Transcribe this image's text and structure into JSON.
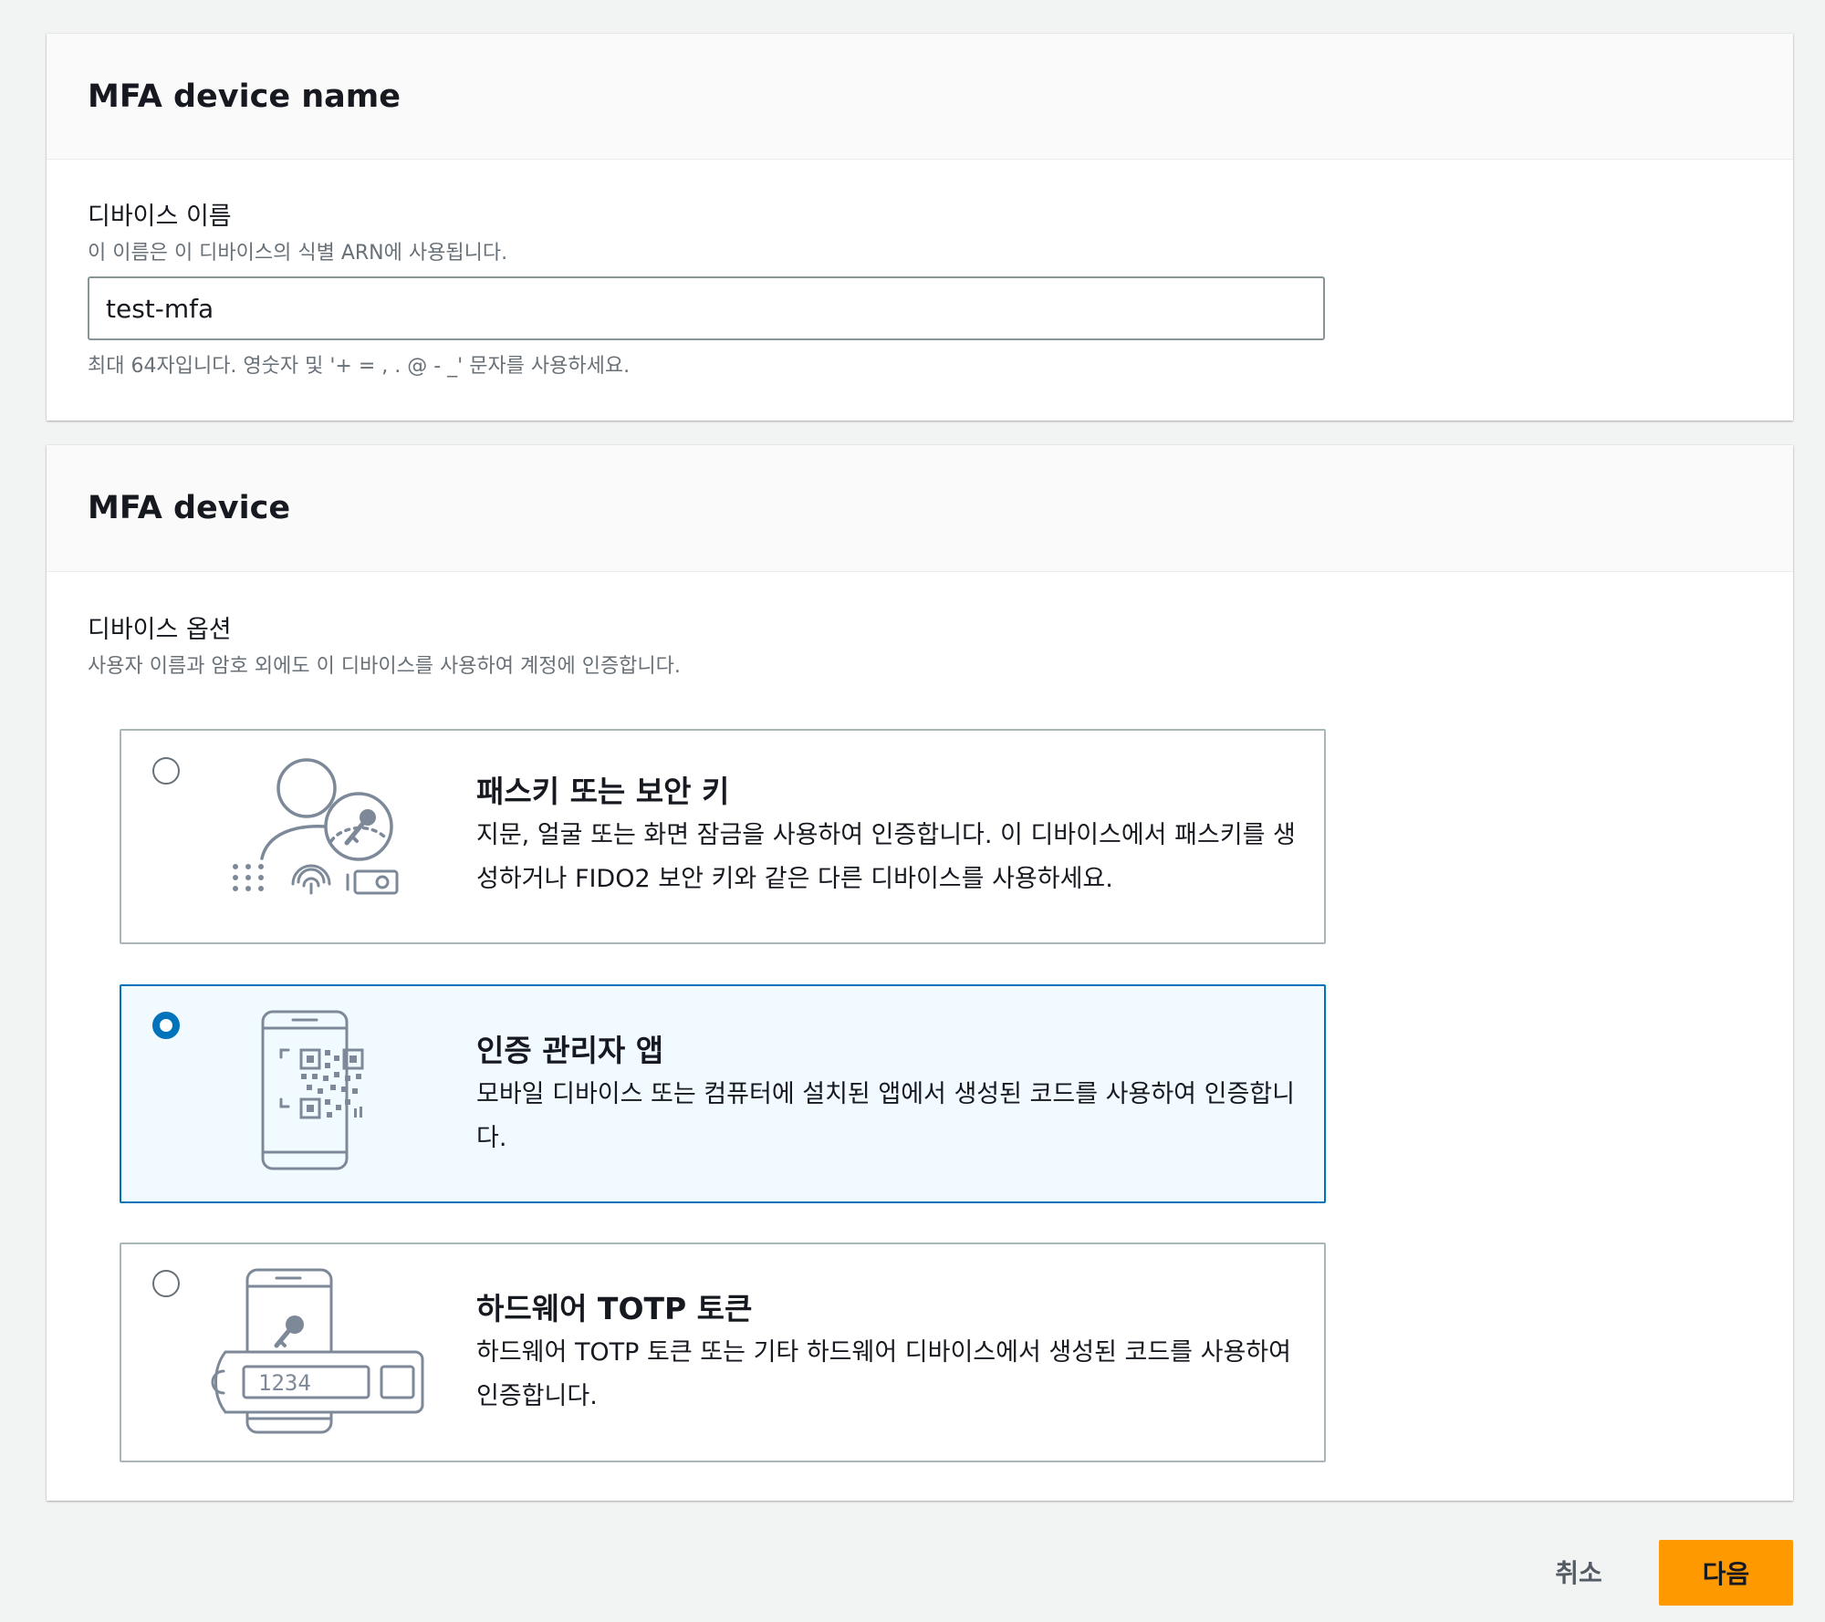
{
  "name_section": {
    "title": "MFA device name",
    "label": "디바이스 이름",
    "description": "이 이름은 이 디바이스의 식별 ARN에 사용됩니다.",
    "value": "test-mfa",
    "constraint": "최대 64자입니다. 영숫자 및 '+ = , . @ - _' 문자를 사용하세요."
  },
  "device_section": {
    "title": "MFA device",
    "label": "디바이스 옵션",
    "description": "사용자 이름과 암호 외에도 이 디바이스를 사용하여 계정에 인증합니다.",
    "selected_option": "authenticator_app",
    "options": [
      {
        "id": "passkey",
        "title": "패스키 또는 보안 키",
        "description": "지문, 얼굴 또는 화면 잠금을 사용하여 인증합니다. 이 디바이스에서 패스키를 생성하거나 FIDO2 보안 키와 같은 다른 디바이스를 사용하세요.",
        "icon": "passkey-user-key-icon",
        "selected": false
      },
      {
        "id": "authenticator_app",
        "title": "인증 관리자 앱",
        "description": "모바일 디바이스 또는 컴퓨터에 설치된 앱에서 생성된 코드를 사용하여 인증합니다.",
        "icon": "phone-qr-code-icon",
        "selected": true
      },
      {
        "id": "hardware_totp",
        "title": "하드웨어 TOTP 토큰",
        "description": "하드웨어 TOTP 토큰 또는 기타 하드웨어 디바이스에서 생성된 코드를 사용하여 인증합니다.",
        "icon": "hardware-token-icon",
        "token_display": "1234",
        "selected": false
      }
    ]
  },
  "footer": {
    "cancel_label": "취소",
    "next_label": "다음"
  },
  "colors": {
    "primary_button": "#ff9900",
    "selected_accent": "#0073bb",
    "selected_background": "#f1faff",
    "page_background": "#f2f3f3"
  }
}
